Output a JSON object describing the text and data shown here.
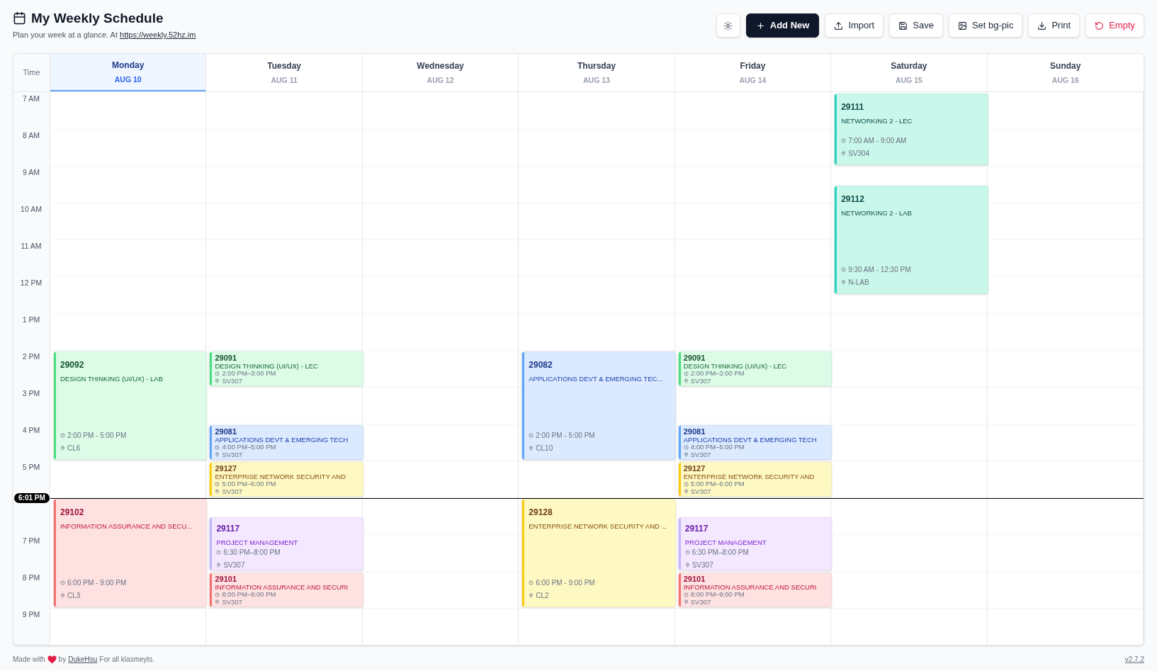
{
  "header": {
    "title": "My Weekly Schedule",
    "subtitle": "Plan your week at a glance. At",
    "subtitle_link": "https://weekly.52hz.im"
  },
  "toolbar": [
    {
      "kind": "icon"
    },
    {
      "kind": "primary",
      "label": "Add New"
    },
    {
      "kind": "default",
      "label": "Import"
    },
    {
      "kind": "default",
      "label": "Save"
    },
    {
      "kind": "default",
      "label": "Set bg-pic"
    },
    {
      "kind": "default",
      "label": "Print"
    },
    {
      "kind": "danger",
      "label": "Empty"
    }
  ],
  "time_column": {
    "heading": "Time",
    "hours": [
      "7 AM",
      "8 AM",
      "9 AM",
      "10 AM",
      "11 AM",
      "12 PM",
      "1 PM",
      "2 PM",
      "3 PM",
      "4 PM",
      "5 PM",
      "7 PM",
      "8 PM",
      "9 PM"
    ]
  },
  "now": {
    "label": "6:01 PM"
  },
  "days": [
    {
      "name": "Monday",
      "date": "AUG 10",
      "selected": true,
      "events": [
        {
          "code": "29092",
          "title": "DESIGN THINKING (UI/UX) - LAB",
          "time": "2:00 PM - 5:00 PM",
          "location": "CL6",
          "color": "#4ade80"
        },
        {
          "code": "29102",
          "title": "INFORMATION ASSURANCE AND SECU...",
          "time": "6:00 PM - 9:00 PM",
          "location": "CL3",
          "color": "#f87171"
        }
      ]
    },
    {
      "name": "Tuesday",
      "date": "AUG 11",
      "selected": false,
      "events": [
        {
          "code": "29091",
          "title": "DESIGN THINKING (UI/UX) - LEC",
          "time": "2:00 PM–3:00 PM",
          "location": "SV307",
          "color": "#4ade80"
        },
        {
          "code": "29081",
          "title": "APPLICATIONS DEVT & EMERGING TECH",
          "time": "4:00 PM–5:00 PM",
          "location": "SV307",
          "color": "#60a5fa"
        },
        {
          "code": "29127",
          "title": "ENTERPRISE NETWORK SECURITY AND",
          "time": "5:00 PM–6:00 PM",
          "location": "SV307",
          "color": "#facc15"
        },
        {
          "code": "29117",
          "title": "PROJECT MANAGEMENT",
          "time": "6:30 PM–8:00 PM",
          "location": "SV307",
          "color": "#c4b5fd"
        },
        {
          "code": "29101",
          "title": "INFORMATION ASSURANCE AND SECURI",
          "time": "8:00 PM–9:00 PM",
          "location": "SV307",
          "color": "#f87171"
        }
      ]
    },
    {
      "name": "Wednesday",
      "date": "AUG 12",
      "selected": false
    },
    {
      "name": "Thursday",
      "date": "AUG 13",
      "selected": false,
      "events": [
        {
          "code": "29082",
          "title": "APPLICATIONS DEVT & EMERGING TEC...",
          "time": "2:00 PM - 5:00 PM",
          "location": "CL10",
          "color": "#60a5fa"
        },
        {
          "code": "29128",
          "title": "ENTERPRISE NETWORK SECURITY AND ...",
          "time": "6:00 PM - 9:00 PM",
          "location": "CL2",
          "color": "#facc15"
        }
      ]
    },
    {
      "name": "Friday",
      "date": "AUG 14",
      "selected": false,
      "events": [
        {
          "code": "29091",
          "title": "DESIGN THINKING (UI/UX) - LEC",
          "time": "2:00 PM–3:00 PM",
          "location": "SV307",
          "color": "#4ade80"
        },
        {
          "code": "29081",
          "title": "APPLICATIONS DEVT & EMERGING TECH",
          "time": "4:00 PM–5:00 PM",
          "location": "SV307",
          "color": "#60a5fa"
        },
        {
          "code": "29127",
          "title": "ENTERPRISE NETWORK SECURITY AND",
          "time": "5:00 PM–6:00 PM",
          "location": "SV307",
          "color": "#facc15"
        },
        {
          "code": "29117",
          "title": "PROJECT MANAGEMENT",
          "time": "6:30 PM–8:00 PM",
          "location": "SV307",
          "color": "#c4b5fd"
        },
        {
          "code": "29101",
          "title": "INFORMATION ASSURANCE AND SECURI",
          "time": "8:00 PM–9:00 PM",
          "location": "SV307",
          "color": "#f87171"
        }
      ]
    },
    {
      "name": "Saturday",
      "date": "AUG 15",
      "selected": false,
      "events": [
        {
          "code": "29111",
          "title": "NETWORKING 2 - LEC",
          "time": "7:00 AM - 9:00 AM",
          "location": "SV304",
          "color": "#2dd4bf"
        },
        {
          "code": "29112",
          "title": "NETWORKING 2 - LAB",
          "time": "9:30 AM - 12:30 PM",
          "location": "N-LAB",
          "color": "#2dd4bf"
        }
      ]
    },
    {
      "name": "Sunday",
      "date": "AUG 16",
      "selected": false
    }
  ],
  "footer": {
    "before": "Made with",
    "middle": "by",
    "link": "DukeHsu",
    "after": "For all klasmeyts.",
    "version": "v2.7.2"
  }
}
